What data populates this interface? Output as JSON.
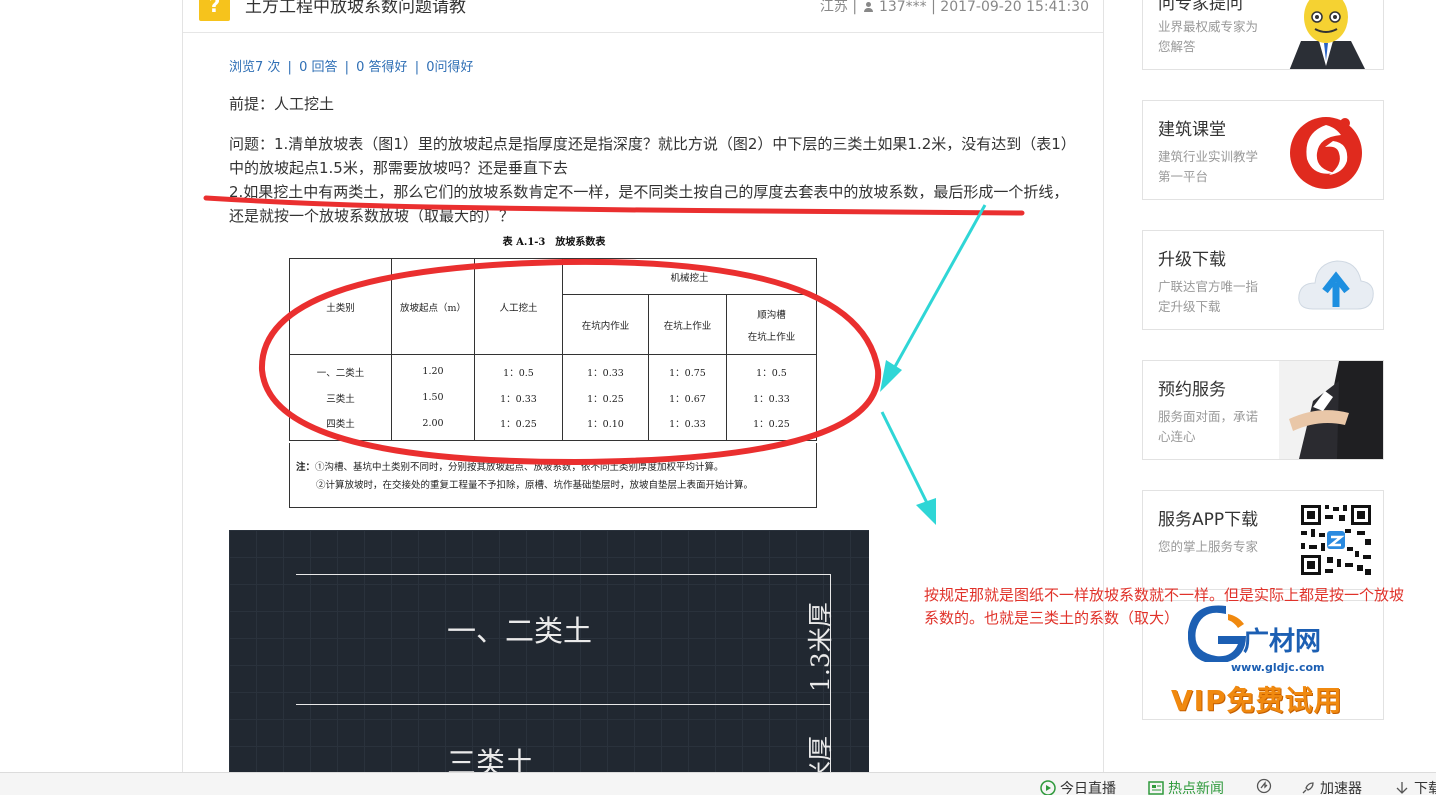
{
  "question": {
    "badge": "?",
    "title": "土方工程中放坡系数问题请教",
    "meta_region": "江苏 |",
    "meta_user": "137***",
    "meta_time": "| 2017-09-20 15:41:30"
  },
  "stats": {
    "views": "浏览7 次",
    "answers": "0 回答",
    "good_answers": "0 答得好",
    "helpful": "0问得好",
    "separator": "|"
  },
  "content": {
    "premise": "前提：人工挖土",
    "q1": "问题：1.清单放坡表（图1）里的放坡起点是指厚度还是指深度？就比方说（图2）中下层的三类土如果1.2米，没有达到（表1）中的放坡起点1.5米，那需要放坡吗？还是垂直下去",
    "q2": "2.如果挖土中有两类土，那么它们的放坡系数肯定不一样，是不同类土按自己的厚度去套表中的放坡系数，最后形成一个折线，还是就按一个放坡系数放坡（取最大的）？"
  },
  "slope_table": {
    "caption": "表 A.1-3　放坡系数表",
    "headers": {
      "soil_type": "土类别",
      "start_point": "放坡起点（m）",
      "manual": "人工挖土",
      "machine": "机械挖土",
      "in_pit": "在坑内作业",
      "on_pit": "在坑上作业",
      "trench_line1": "顺沟槽",
      "trench_line2": "在坑上作业"
    },
    "rows": [
      {
        "soil": "一、二类土",
        "start": "1.20",
        "manual": "1：0.5",
        "in_pit": "1：0.33",
        "on_pit": "1：0.75",
        "trench": "1：0.5"
      },
      {
        "soil": "三类土",
        "start": "1.50",
        "manual": "1：0.33",
        "in_pit": "1：0.25",
        "on_pit": "1：0.67",
        "trench": "1：0.33"
      },
      {
        "soil": "四类土",
        "start": "2.00",
        "manual": "1：0.25",
        "in_pit": "1：0.10",
        "on_pit": "1：0.33",
        "trench": "1：0.25"
      }
    ],
    "note_label": "注：",
    "note1": "①沟槽、基坑中土类别不同时，分别按其放坡起点、放坡系数，依不同土类别厚度加权平均计算。",
    "note2": "②计算放坡时，在交接处的重复工程量不予扣除，原槽、坑作基础垫层时，放坡自垫层上表面开始计算。"
  },
  "cad": {
    "label_top": "一、二类土",
    "label_bottom": "三类土",
    "dim_top": "1.3米厚",
    "dim_bottom": "米厚"
  },
  "annotation": {
    "text": "按规定那就是图纸不一样放坡系数就不一样。但是实际上都是按一个放坡系数的。也就是三类土的系数（取大）",
    "color": "#e0322a",
    "arrow_color": "#2fd6d6"
  },
  "sidebar": {
    "ask_expert": {
      "title": "问专家提问",
      "desc": "业界最权威专家为您解答"
    },
    "classroom": {
      "title": "建筑课堂",
      "desc": "建筑行业实训教学第一平台"
    },
    "upgrade": {
      "title": "升级下载",
      "desc": "广联达官方唯一指定升级下载"
    },
    "service": {
      "title": "预约服务",
      "desc": "服务面对面，承诺心连心"
    },
    "app": {
      "title": "服务APP下载",
      "desc": "您的掌上服务专家"
    },
    "ad": {
      "logo_text": "广材网",
      "url": "www.gldjc.com",
      "vip": "VIP免费试用"
    }
  },
  "bottom_bar": {
    "live": "今日直播",
    "news": "热点新闻",
    "accelerator": "加速器",
    "download": "下载"
  }
}
